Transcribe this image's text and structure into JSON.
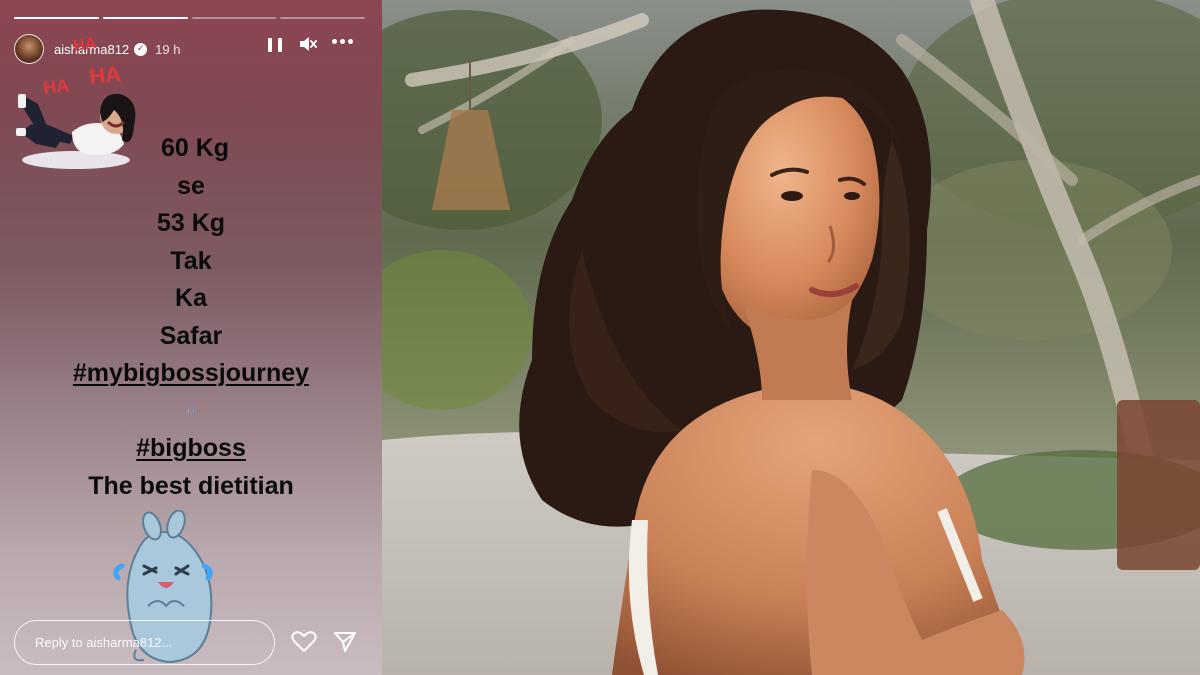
{
  "story": {
    "username": "aisharma812",
    "time_ago": "19 h",
    "progress": [
      1,
      1,
      0,
      0
    ],
    "sticker_top_text": [
      "HA",
      "HA",
      "HA"
    ],
    "caption_lines": [
      "60 Kg",
      "se",
      "53 Kg",
      "Tak",
      "Ka",
      "Safar"
    ],
    "hashtag_1": "#mybigbossjourney",
    "hashtag_2": "#bigboss",
    "last_line": "The best dietitian",
    "emojis": [
      "laughing-with-tears",
      "rolling-on-floor-laughing",
      "laughing-with-tears",
      "rolling-on-floor-laughing"
    ],
    "reply_placeholder": "Reply to aisharma812..."
  },
  "colors": {
    "story_bg_top": "#8c4552",
    "story_bg_bottom": "#c9bcc0",
    "caption_text": "#0a0a0a"
  }
}
